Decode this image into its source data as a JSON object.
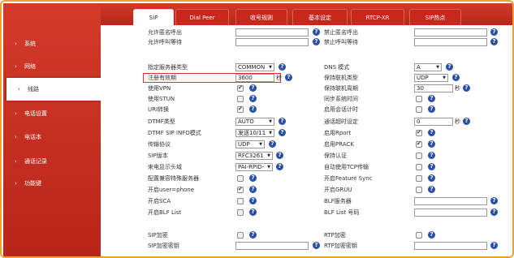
{
  "tabs": [
    {
      "label": "SIP"
    },
    {
      "label": "Dial Peer"
    },
    {
      "label": "收号规则"
    },
    {
      "label": "基本设定"
    },
    {
      "label": "RTCP-XR"
    },
    {
      "label": "SIP热点"
    }
  ],
  "sidebar": {
    "items": [
      {
        "label": "系统"
      },
      {
        "label": "网络"
      },
      {
        "label": "线路"
      },
      {
        "label": "电话设置"
      },
      {
        "label": "电话本"
      },
      {
        "label": "通话记录"
      },
      {
        "label": "功能键"
      }
    ]
  },
  "left": {
    "allow_anonymous": "允许匿名呼出",
    "allow_wait": "允许呼叫等待",
    "server_type": "指定服务器类型",
    "server_type_val": "COMMON",
    "reg_expire": "注册有效期",
    "reg_expire_val": "3600",
    "reg_expire_unit": "秒",
    "use_vpn": "使用VPN",
    "use_stun": "使用STUN",
    "uri_convert": "URI转换",
    "dtmf_type": "DTMF类型",
    "dtmf_type_val": "AUTO",
    "dtmf_info": "DTMF SIP INFO模式",
    "dtmf_info_val": "发送10/11",
    "transport": "传输协议",
    "transport_val": "UDP",
    "sip_version": "SIP版本",
    "sip_version_val": "RFC3261",
    "caller_id": "来电显示头域",
    "caller_id_val": "PAI-RPID-",
    "private_server": "配置兼容特殊服务器",
    "user_phone": "开启user=phone",
    "sca": "开启SCA",
    "blf_list": "开启BLF List",
    "sip_encrypt": "SIP加密",
    "sip_encrypt_key": "SIP加密密钥"
  },
  "right": {
    "block_anonymous": "禁止匿名呼出",
    "block_wait": "禁止呼叫等待",
    "dns_mode": "DNS 模式",
    "dns_mode_val": "A",
    "keepalive_type": "保持联机类型",
    "keepalive_type_val": "UDP",
    "keepalive_period": "保持联机周期",
    "keepalive_period_val": "30",
    "keepalive_unit": "秒",
    "sync_time": "同步系统时间",
    "session_timer": "启用会话计时",
    "session_timeout": "通话超时设定",
    "session_timeout_val": "0",
    "session_timeout_unit": "秒",
    "rport": "启用Rport",
    "prack": "启用PRACK",
    "keep_auth": "保持认证",
    "auto_tcp": "自动使用TCP传输",
    "feature_sync": "开启Feature Sync",
    "gruu": "开启GRUU",
    "blf_server": "BLF服务器",
    "blf_list_num": "BLF List 号码",
    "rtp_encrypt": "RTP加密",
    "rtp_encrypt_key": "RTP加密密钥"
  },
  "help_icon": "?",
  "colors": {
    "accent": "#c8281c",
    "help": "#2a4fa8",
    "highlight": "#e03030"
  }
}
